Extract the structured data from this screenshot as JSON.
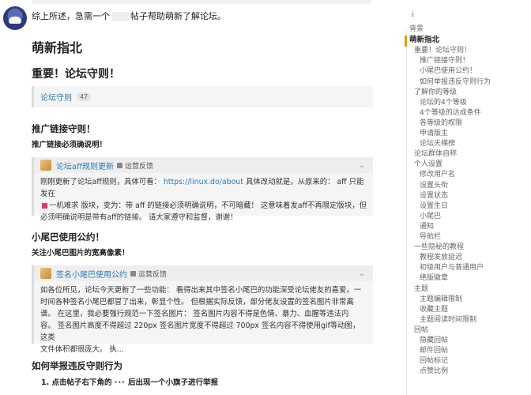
{
  "post": {
    "intro_before": "综上所述，急需一个",
    "intro_after": "帖子帮助萌新了解论坛。",
    "title": "萌新指北",
    "section1": "重要！论坛守则！",
    "category": {
      "label": "论坛守则",
      "count": "47"
    },
    "promo": {
      "heading": "推广链接守则！",
      "note": "推广链接必须确说明！",
      "quote": {
        "link": "论坛aff规则更新",
        "tag": "运营反馈",
        "line1_before": "刚刚更新了论坛aff规则，具体可看：",
        "url": "https://linux.do/about",
        "line1_after": "具体改动就是，从原来的： aff 只能发在",
        "line2": "一机难求 版块，变为：带 aff 的链接必须明确说明，不可暗藏！ 这意味着发aff不再限定版块，但",
        "line3": "必须明确说明是带有aff的链接。 请大家遵守和监督，谢谢！"
      }
    },
    "sig": {
      "heading": "小尾巴使用公约！",
      "note": "关注小尾巴图片的宽高像素！",
      "quote": {
        "link": "签名小尾巴使用公约",
        "tag": "运营反馈",
        "lines": [
          "如各位所见，论坛今天更新了一些功能： 看得出来其中签名小尾巴的功能深受论坛佬友的喜爱。一",
          "时间各种签名小尾巴都冒了出来，彰显个性。 但根据实际反馈，部分佬友设置的签名图片非常离",
          "谱。 在这里，我必要强行规范一下签名图片： 签名图片内容不得是色情、暴力、血腥等违法内",
          "容。 签名图片高度不得超过 220px 签名图片宽度不得超过 700px 签名内容不得使用gif等动图，这类",
          "文件体积都很庞大。 执..."
        ]
      }
    },
    "report": {
      "heading": "如何举报违反守则行为",
      "step1_before": "1. 点击帖子右下角的",
      "step1_dots": "···",
      "step1_after": "后出现一个小旗子进行举报"
    }
  },
  "toc": {
    "download_icon": "⤓",
    "items": [
      {
        "label": "背景",
        "indent": 0
      },
      {
        "label": "萌新指北",
        "indent": 0,
        "active": true
      },
      {
        "label": "重要！论坛守则！",
        "indent": 1
      },
      {
        "label": "推广链接守则！",
        "indent": 2
      },
      {
        "label": "小尾巴使用公约！",
        "indent": 2
      },
      {
        "label": "如何举报违反守则行为",
        "indent": 2
      },
      {
        "label": "了解你的等级",
        "indent": 1
      },
      {
        "label": "论坛的4个等级",
        "indent": 2
      },
      {
        "label": "4个等级的达成条件",
        "indent": 2
      },
      {
        "label": "各等级的权限",
        "indent": 2
      },
      {
        "label": "申请版主",
        "indent": 2
      },
      {
        "label": "论坛天梯榜",
        "indent": 2
      },
      {
        "label": "论坛群体自称",
        "indent": 1
      },
      {
        "label": "个人设置",
        "indent": 1
      },
      {
        "label": "修改用户名",
        "indent": 2
      },
      {
        "label": "设置头衔",
        "indent": 2
      },
      {
        "label": "设置状态",
        "indent": 2
      },
      {
        "label": "设置生日",
        "indent": 2
      },
      {
        "label": "小尾巴",
        "indent": 2
      },
      {
        "label": "通知",
        "indent": 2
      },
      {
        "label": "导航栏",
        "indent": 2
      },
      {
        "label": "一些隐秘的教程",
        "indent": 1
      },
      {
        "label": "教程发放延迟",
        "indent": 2
      },
      {
        "label": "初级用户与普通用户",
        "indent": 2
      },
      {
        "label": "绝版徽章",
        "indent": 2
      },
      {
        "label": "主题",
        "indent": 1
      },
      {
        "label": "主题编辑限制",
        "indent": 2
      },
      {
        "label": "收藏主题",
        "indent": 2
      },
      {
        "label": "主题阅读时间限制",
        "indent": 2
      },
      {
        "label": "回帖",
        "indent": 1
      },
      {
        "label": "隐藏回帖",
        "indent": 2
      },
      {
        "label": "邮件回帖",
        "indent": 2
      },
      {
        "label": "回帖标记",
        "indent": 2
      },
      {
        "label": "点赞比例",
        "indent": 2
      }
    ]
  }
}
